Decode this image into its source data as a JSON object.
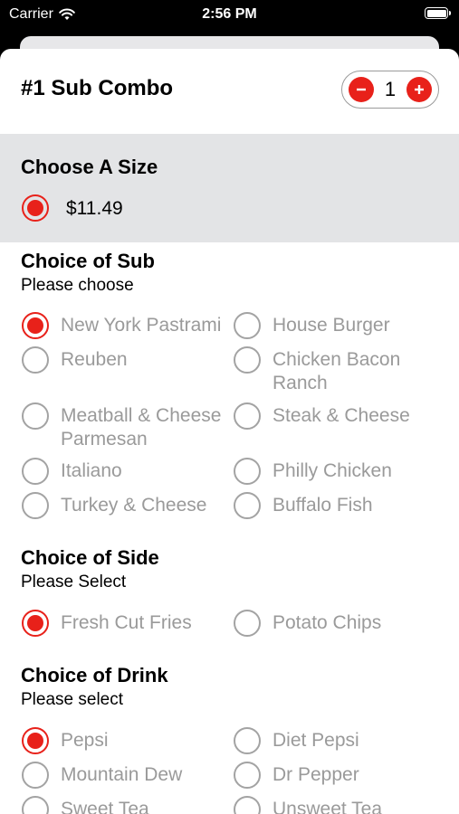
{
  "status_bar": {
    "carrier": "Carrier",
    "time": "2:56 PM"
  },
  "item": {
    "title": "#1 Sub Combo",
    "quantity": "1"
  },
  "size": {
    "title": "Choose A Size",
    "price": "$11.49"
  },
  "sub": {
    "title": "Choice of Sub",
    "subtitle": "Please choose",
    "options": [
      {
        "label": "New York Pastrami",
        "selected": true
      },
      {
        "label": "House Burger",
        "selected": false
      },
      {
        "label": "Reuben",
        "selected": false
      },
      {
        "label": "Chicken Bacon Ranch",
        "selected": false
      },
      {
        "label": "Meatball & Cheese Parmesan",
        "selected": false
      },
      {
        "label": "Steak & Cheese",
        "selected": false
      },
      {
        "label": "Italiano",
        "selected": false
      },
      {
        "label": "Philly Chicken",
        "selected": false
      },
      {
        "label": "Turkey & Cheese",
        "selected": false
      },
      {
        "label": "Buffalo Fish",
        "selected": false
      }
    ]
  },
  "side": {
    "title": "Choice of Side",
    "subtitle": "Please Select",
    "options": [
      {
        "label": "Fresh Cut Fries",
        "selected": true
      },
      {
        "label": "Potato Chips",
        "selected": false
      }
    ]
  },
  "drink": {
    "title": "Choice of Drink",
    "subtitle": "Please select",
    "options": [
      {
        "label": "Pepsi",
        "selected": true
      },
      {
        "label": "Diet Pepsi",
        "selected": false
      },
      {
        "label": "Mountain Dew",
        "selected": false
      },
      {
        "label": "Dr Pepper",
        "selected": false
      },
      {
        "label": "Sweet Tea",
        "selected": false
      },
      {
        "label": "Unsweet Tea",
        "selected": false
      }
    ]
  },
  "colors": {
    "accent": "#e8211a",
    "muted_text": "#9a9a9a",
    "section_bg": "#e3e4e6"
  }
}
